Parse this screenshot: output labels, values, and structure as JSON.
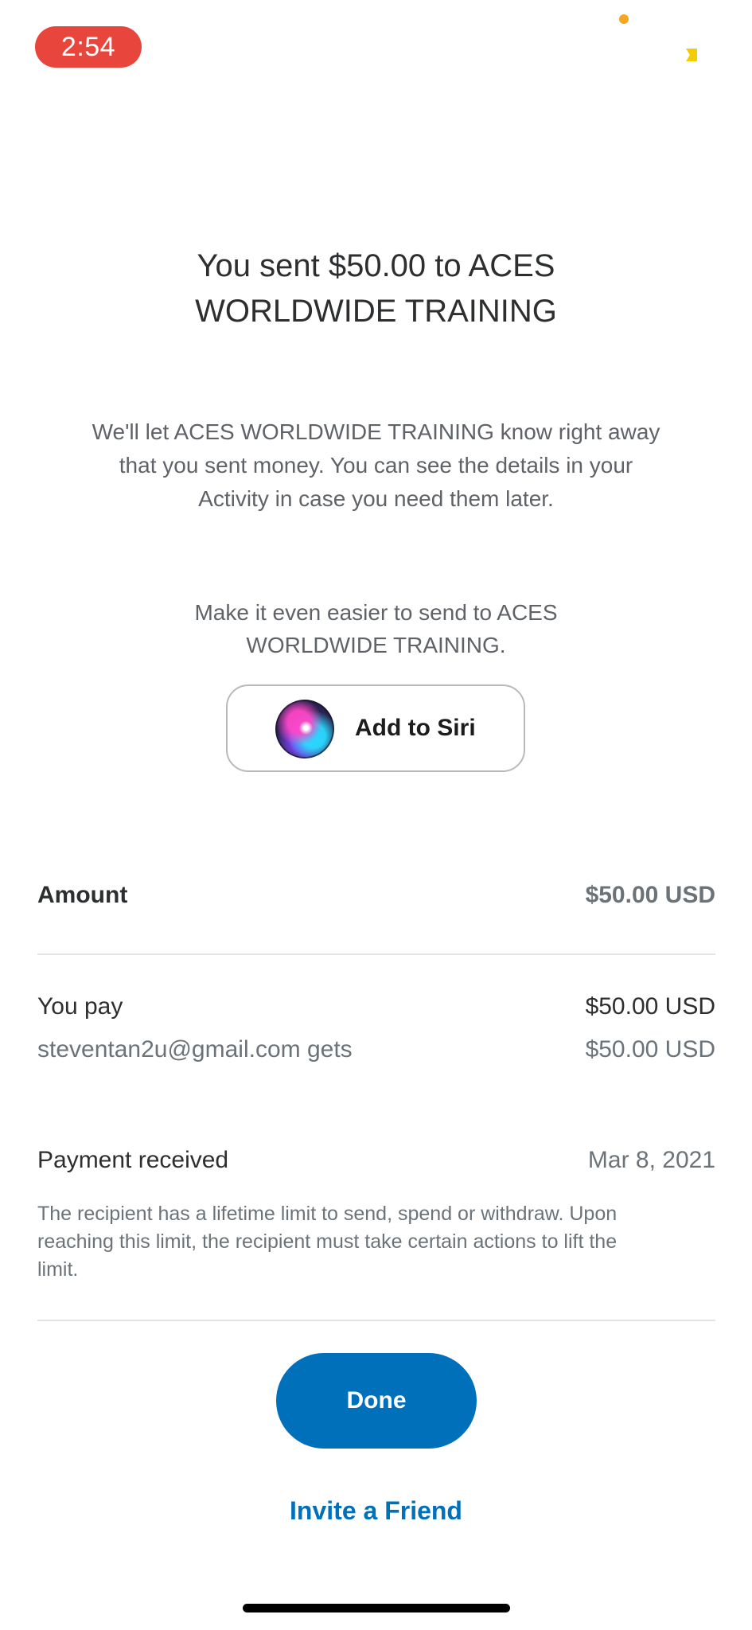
{
  "status_bar": {
    "time": "2:54"
  },
  "confirmation": {
    "headline_line1": "You sent $50.00 to ACES",
    "headline_line2": "WORLDWIDE TRAINING",
    "description_line1": "We'll let ACES WORLDWIDE TRAINING know right away",
    "description_line2": "that you sent money. You can see the details in your",
    "description_line3": "Activity in case you need them later."
  },
  "siri": {
    "prompt_line1": "Make it even easier to send to ACES",
    "prompt_line2": "WORLDWIDE TRAINING.",
    "button_label": "Add to Siri",
    "icon": "siri-icon"
  },
  "details": {
    "amount_label": "Amount",
    "amount_value": "$50.00 USD",
    "you_pay_label": "You pay",
    "you_pay_value": "$50.00 USD",
    "recipient_gets_label": "steventan2u@gmail.com gets",
    "recipient_gets_value": "$50.00 USD",
    "payment_status_label": "Payment received",
    "payment_date": "Mar 8, 2021",
    "limit_note_line1": "The recipient has a lifetime limit to send, spend or withdraw. Upon",
    "limit_note_line2": "reaching this limit, the recipient must take certain actions to lift the",
    "limit_note_line3": "limit."
  },
  "actions": {
    "done_label": "Done",
    "invite_label": "Invite a Friend"
  },
  "colors": {
    "brand_blue": "#0070ba",
    "time_pill": "#e8453c",
    "primary_text": "#2c2e2f",
    "secondary_text": "#6c7378"
  }
}
